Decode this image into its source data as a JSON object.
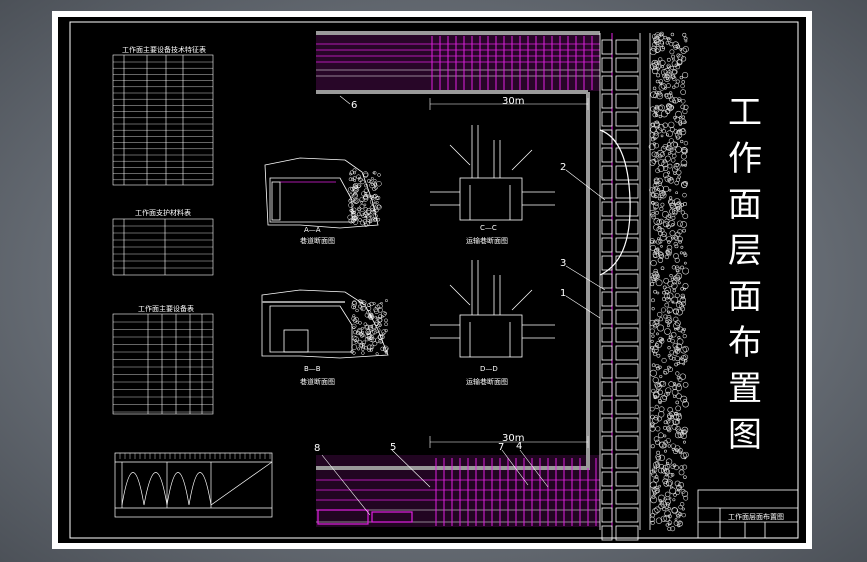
{
  "title_chars": [
    "工",
    "作",
    "面",
    "层",
    "面",
    "布",
    "置",
    "图"
  ],
  "dimension_top": "30m",
  "dimension_bottom": "30m",
  "callouts": [
    "1",
    "2",
    "3",
    "4",
    "5",
    "6",
    "7",
    "8"
  ],
  "table1_title": "工作面主要设备技术特征表",
  "table2_title": "工作面支护材料表",
  "table3_title": "工作面主要设备表",
  "section_AA": "A—A",
  "section_BB": "B—B",
  "section_CC": "C—C",
  "section_DD": "D—D",
  "caption_AA": "巷道断面图",
  "caption_BB": "巷道断面图",
  "caption_CC": "运输巷断面图",
  "caption_DD": "运输巷断面图",
  "titleblock_name": "工作面层面布置图",
  "colors": {
    "magenta": "#e020e0",
    "white": "#ffffff",
    "gray": "#9a9a9a",
    "black": "#000000"
  }
}
